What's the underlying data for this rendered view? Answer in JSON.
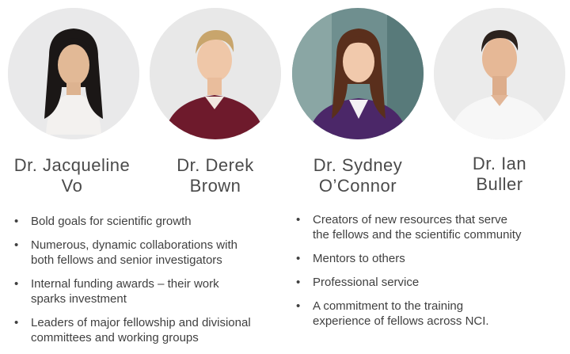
{
  "people": [
    {
      "name_line1": "Dr. Jacqueline",
      "name_line2": "Vo",
      "photo": "portrait-jacqueline-vo"
    },
    {
      "name_line1": "Dr. Derek",
      "name_line2": "Brown",
      "photo": "portrait-derek-brown"
    },
    {
      "name_line1": "Dr. Sydney",
      "name_line2": "O’Connor",
      "photo": "portrait-sydney-oconnor"
    },
    {
      "name_line1": "Dr. Ian",
      "name_line2": "Buller",
      "photo": "portrait-ian-buller"
    }
  ],
  "left_bullets": [
    {
      "line1": "Bold goals for scientific growth"
    },
    {
      "line1": "Numerous, dynamic collaborations with",
      "line2": "both fellows and senior investigators"
    },
    {
      "line1": "Internal funding awards – their work",
      "line2": "sparks investment"
    },
    {
      "line1": "Leaders of major fellowship and divisional",
      "line2": "committees and working groups"
    }
  ],
  "right_bullets": [
    {
      "line1": "Creators of new resources that serve",
      "line2": "the fellows and the scientific community"
    },
    {
      "line1": "Mentors to others"
    },
    {
      "line1": "Professional service"
    },
    {
      "line1": "A commitment to the training",
      "line2": "experience of fellows across NCI."
    }
  ]
}
